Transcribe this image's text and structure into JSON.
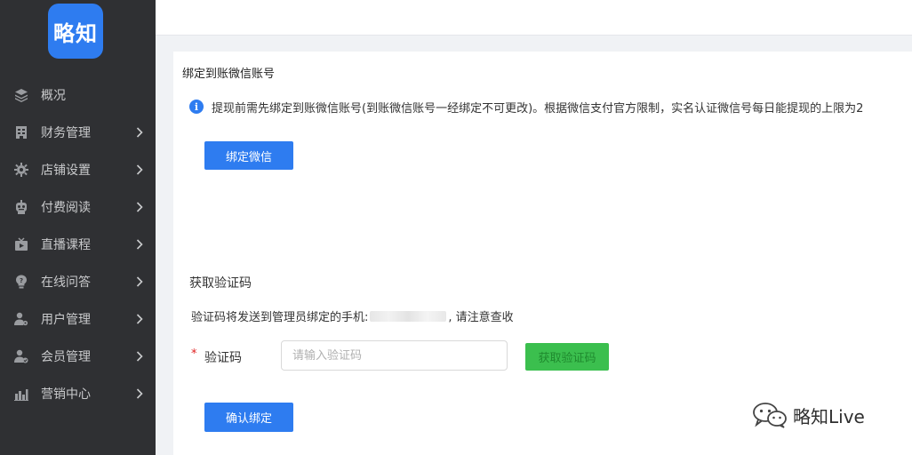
{
  "brand": {
    "logo_text": "略知",
    "logo_color": "#2e7cf0"
  },
  "sidebar": {
    "items": [
      {
        "label": "概况",
        "icon": "layers-icon",
        "has_arrow": false
      },
      {
        "label": "财务管理",
        "icon": "finance-icon",
        "has_arrow": true
      },
      {
        "label": "店铺设置",
        "icon": "gear-icon",
        "has_arrow": true
      },
      {
        "label": "付费阅读",
        "icon": "robot-icon",
        "has_arrow": true
      },
      {
        "label": "直播课程",
        "icon": "tv-icon",
        "has_arrow": true
      },
      {
        "label": "在线问答",
        "icon": "lightbulb-icon",
        "has_arrow": true
      },
      {
        "label": "用户管理",
        "icon": "user-gear-icon",
        "has_arrow": true
      },
      {
        "label": "会员管理",
        "icon": "member-icon",
        "has_arrow": true
      },
      {
        "label": "营销中心",
        "icon": "chart-icon",
        "has_arrow": true
      }
    ]
  },
  "bind_section": {
    "title": "绑定到账微信账号",
    "notice": "提现前需先绑定到账微信账号(到账微信账号一经绑定不可更改)。根据微信支付官方限制，实名认证微信号每日能提现的上限为2",
    "bind_button": "绑定微信"
  },
  "verify_section": {
    "title": "获取验证码",
    "hint_prefix": "验证码将发送到管理员绑定的手机:",
    "hint_suffix": ", 请注意查收",
    "required_mark": "*",
    "field_label": "验证码",
    "input_placeholder": "请输入验证码",
    "input_value": "",
    "get_code_button": "获取验证码",
    "confirm_button": "确认绑定"
  },
  "watermark": {
    "text": "略知Live",
    "icon": "wechat-icon"
  },
  "colors": {
    "sidebar_bg": "#2f3033",
    "primary": "#2e7cf0",
    "success": "#3bbf4e",
    "danger": "#e02020"
  }
}
